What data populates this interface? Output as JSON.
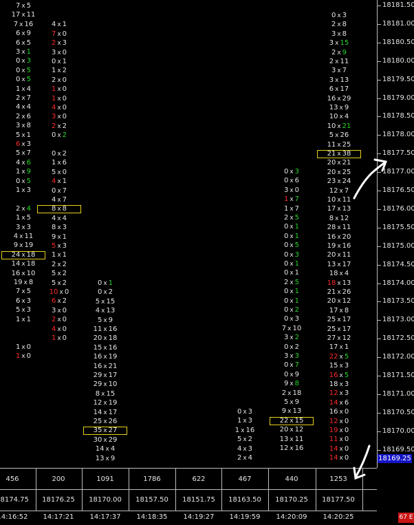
{
  "price_axis": {
    "labels": [
      "18181.50",
      "18181.00",
      "18180.50",
      "18180.00",
      "18179.50",
      "18179.00",
      "18178.50",
      "18178.00",
      "18177.50",
      "18177.00",
      "18176.50",
      "18176.00",
      "18175.50",
      "18175.00",
      "18174.50",
      "18174.00",
      "18173.50",
      "18173.00",
      "18172.50",
      "18172.00",
      "18171.50",
      "18171.00",
      "18170.50",
      "18170.00",
      "18169.50"
    ],
    "current_price": "18169.25"
  },
  "columns": [
    {
      "volume": "456",
      "close_price": "18174.75",
      "time": "14:16:52",
      "rows": [
        [
          "7",
          "5",
          ""
        ],
        [
          "17",
          "11",
          ""
        ],
        [
          "7",
          "16",
          ""
        ],
        [
          "6",
          "9",
          ""
        ],
        [
          "6",
          "5",
          ""
        ],
        [
          "3",
          "1",
          "a"
        ],
        [
          "0",
          "3",
          "a"
        ],
        [
          "0",
          "5",
          "a"
        ],
        [
          "0",
          "5",
          "a"
        ],
        [
          "1",
          "4",
          ""
        ],
        [
          "2",
          "7",
          ""
        ],
        [
          "4",
          "4",
          ""
        ],
        [
          "2",
          "6",
          ""
        ],
        [
          "3",
          "8",
          ""
        ],
        [
          "5",
          "1",
          ""
        ],
        [
          "6",
          "3",
          "b"
        ],
        [
          "5",
          "7",
          ""
        ],
        [
          "4",
          "6",
          "a"
        ],
        [
          "1",
          "9",
          "a"
        ],
        [
          "0",
          "5",
          "a"
        ],
        [
          "1",
          "3",
          ""
        ],
        [
          "",
          ""
        ],
        [
          "2",
          "4",
          "a"
        ],
        [
          "1",
          "5",
          ""
        ],
        [
          "3",
          "3",
          ""
        ],
        [
          "4",
          "11",
          ""
        ],
        [
          "9",
          "19",
          ""
        ],
        [
          "24",
          "18",
          "",
          true
        ],
        [
          "14",
          "18",
          ""
        ],
        [
          "16",
          "10",
          ""
        ],
        [
          "19",
          "8",
          ""
        ],
        [
          "7",
          "5",
          ""
        ],
        [
          "6",
          "3",
          ""
        ],
        [
          "5",
          "3",
          ""
        ],
        [
          "1",
          "1",
          ""
        ],
        [
          "",
          ""
        ],
        [
          "",
          ""
        ],
        [
          "1",
          "0",
          ""
        ],
        [
          "1",
          "0",
          "b"
        ]
      ]
    },
    {
      "volume": "200",
      "close_price": "18176.25",
      "time": "14:17:21",
      "rows": [
        [
          "",
          ""
        ],
        [
          "4",
          "1",
          ""
        ],
        [
          "7",
          "0",
          "b"
        ],
        [
          "2",
          "3",
          "b"
        ],
        [
          "3",
          "0",
          ""
        ],
        [
          "0",
          "1",
          ""
        ],
        [
          "1",
          "2",
          ""
        ],
        [
          "2",
          "0",
          ""
        ],
        [
          "1",
          "0",
          "b"
        ],
        [
          "1",
          "0",
          "b"
        ],
        [
          "4",
          "0",
          "b"
        ],
        [
          "3",
          "0",
          "b"
        ],
        [
          "2",
          "2",
          "b"
        ],
        [
          "0",
          "2",
          "a"
        ],
        [
          "",
          ""
        ],
        [
          "0",
          "2",
          ""
        ],
        [
          "1",
          "6",
          ""
        ],
        [
          "5",
          "0",
          ""
        ],
        [
          "4",
          "1",
          "b"
        ],
        [
          "0",
          "7",
          ""
        ],
        [
          "4",
          "7",
          ""
        ],
        [
          "8",
          "8",
          "",
          true
        ],
        [
          "4",
          "4",
          ""
        ],
        [
          "8",
          "3",
          ""
        ],
        [
          "9",
          "1",
          ""
        ],
        [
          "5",
          "3",
          "b"
        ],
        [
          "1",
          "1",
          ""
        ],
        [
          "2",
          "2",
          ""
        ],
        [
          "5",
          "2",
          ""
        ],
        [
          "5",
          "2",
          ""
        ],
        [
          "10",
          "0",
          "b"
        ],
        [
          "6",
          "2",
          "b"
        ],
        [
          "3",
          "0",
          ""
        ],
        [
          "2",
          "0",
          "b"
        ],
        [
          "4",
          "0",
          "b"
        ],
        [
          "1",
          "0",
          "b"
        ]
      ]
    },
    {
      "volume": "1091",
      "close_price": "18170.00",
      "time": "14:17:37",
      "rows": [
        [
          "0",
          "1",
          "a"
        ],
        [
          "0",
          "2",
          ""
        ],
        [
          "5",
          "15",
          ""
        ],
        [
          "4",
          "13",
          ""
        ],
        [
          "5",
          "9",
          ""
        ],
        [
          "11",
          "16",
          ""
        ],
        [
          "20",
          "18",
          ""
        ],
        [
          "15",
          "16",
          ""
        ],
        [
          "16",
          "19",
          ""
        ],
        [
          "16",
          "21",
          ""
        ],
        [
          "29",
          "17",
          ""
        ],
        [
          "29",
          "10",
          ""
        ],
        [
          "8",
          "15",
          ""
        ],
        [
          "12",
          "19",
          ""
        ],
        [
          "14",
          "17",
          ""
        ],
        [
          "25",
          "26",
          ""
        ],
        [
          "35",
          "27",
          "",
          true
        ],
        [
          "30",
          "29",
          ""
        ],
        [
          "14",
          "4",
          ""
        ],
        [
          "13",
          "9",
          ""
        ]
      ]
    },
    {
      "volume": "1786",
      "close_price": "18157.50",
      "time": "14:18:35",
      "rows": []
    },
    {
      "volume": "622",
      "close_price": "18151.75",
      "time": "14:19:27",
      "rows": []
    },
    {
      "volume": "467",
      "close_price": "18163.50",
      "time": "14:19:59",
      "rows": [
        [
          "0",
          "3",
          ""
        ],
        [
          "1",
          "3",
          ""
        ],
        [
          "1",
          "16",
          ""
        ],
        [
          "5",
          "2",
          ""
        ],
        [
          "4",
          "3",
          ""
        ],
        [
          "2",
          "4",
          ""
        ]
      ]
    },
    {
      "volume": "440",
      "close_price": "18170.25",
      "time": "14:20:09",
      "rows": [
        [
          "0",
          "3",
          "a"
        ],
        [
          "0",
          "6",
          ""
        ],
        [
          "3",
          "0",
          ""
        ],
        [
          "1",
          "7",
          "ba"
        ],
        [
          "1",
          "7",
          ""
        ],
        [
          "2",
          "5",
          "a"
        ],
        [
          "0",
          "1",
          "a"
        ],
        [
          "0",
          "1",
          "a"
        ],
        [
          "0",
          "5",
          "a"
        ],
        [
          "0",
          "3",
          "a"
        ],
        [
          "0",
          "1",
          "a"
        ],
        [
          "0",
          "1",
          ""
        ],
        [
          "2",
          "5",
          "a"
        ],
        [
          "0",
          "1",
          "a"
        ],
        [
          "0",
          "1",
          "a"
        ],
        [
          "0",
          "2",
          "a"
        ],
        [
          "0",
          "3",
          ""
        ],
        [
          "7",
          "10",
          ""
        ],
        [
          "3",
          "2",
          "a"
        ],
        [
          "0",
          "2",
          ""
        ],
        [
          "3",
          "3",
          "a"
        ],
        [
          "0",
          "7",
          "a"
        ],
        [
          "0",
          "9",
          ""
        ],
        [
          "9",
          "8",
          "a"
        ],
        [
          "2",
          "18",
          ""
        ],
        [
          "5",
          "9",
          ""
        ],
        [
          "9",
          "13",
          ""
        ],
        [
          "22",
          "15",
          "",
          true
        ],
        [
          "20",
          "12",
          ""
        ],
        [
          "13",
          "11",
          ""
        ],
        [
          "12",
          "16",
          ""
        ]
      ]
    },
    {
      "volume": "1253",
      "close_price": "18177.50",
      "time": "14:20:25",
      "rows": [
        [
          "0",
          "3",
          ""
        ],
        [
          "2",
          "8",
          ""
        ],
        [
          "3",
          "8",
          ""
        ],
        [
          "3",
          "15",
          "a"
        ],
        [
          "2",
          "9",
          "a"
        ],
        [
          "2",
          "11",
          ""
        ],
        [
          "3",
          "7",
          ""
        ],
        [
          "3",
          "13",
          ""
        ],
        [
          "6",
          "17",
          ""
        ],
        [
          "16",
          "29",
          ""
        ],
        [
          "13",
          "9",
          ""
        ],
        [
          "10",
          "4",
          ""
        ],
        [
          "10",
          "21",
          "a"
        ],
        [
          "5",
          "26",
          ""
        ],
        [
          "11",
          "25",
          ""
        ],
        [
          "21",
          "38",
          "",
          true
        ],
        [
          "20",
          "21",
          ""
        ],
        [
          "20",
          "25",
          ""
        ],
        [
          "23",
          "24",
          ""
        ],
        [
          "12",
          "7",
          ""
        ],
        [
          "10",
          "11",
          ""
        ],
        [
          "17",
          "13",
          ""
        ],
        [
          "8",
          "12",
          ""
        ],
        [
          "28",
          "11",
          ""
        ],
        [
          "16",
          "20",
          ""
        ],
        [
          "19",
          "16",
          ""
        ],
        [
          "20",
          "11",
          ""
        ],
        [
          "13",
          "17",
          ""
        ],
        [
          "18",
          "4",
          ""
        ],
        [
          "18",
          "13",
          "b"
        ],
        [
          "21",
          "26",
          ""
        ],
        [
          "20",
          "12",
          ""
        ],
        [
          "17",
          "8",
          ""
        ],
        [
          "25",
          "17",
          ""
        ],
        [
          "25",
          "17",
          ""
        ],
        [
          "27",
          "12",
          ""
        ],
        [
          "17",
          "1",
          ""
        ],
        [
          "22",
          "5",
          "ba"
        ],
        [
          "15",
          "3",
          ""
        ],
        [
          "16",
          "5",
          "ba"
        ],
        [
          "18",
          "3",
          ""
        ],
        [
          "12",
          "3",
          "b"
        ],
        [
          "14",
          "6",
          "b"
        ],
        [
          "16",
          "0",
          ""
        ],
        [
          "12",
          "0",
          "b"
        ],
        [
          "19",
          "0",
          "b"
        ],
        [
          "11",
          "0",
          "b"
        ],
        [
          "14",
          "0",
          "b"
        ],
        [
          "14",
          "0",
          "b"
        ]
      ]
    }
  ],
  "badge": "67 E",
  "colors": {
    "bid_sell": "#ff2b2b",
    "ask_buy": "#27d827",
    "highlight": "#e7d31a",
    "current_price_bg": "#1515c8"
  }
}
